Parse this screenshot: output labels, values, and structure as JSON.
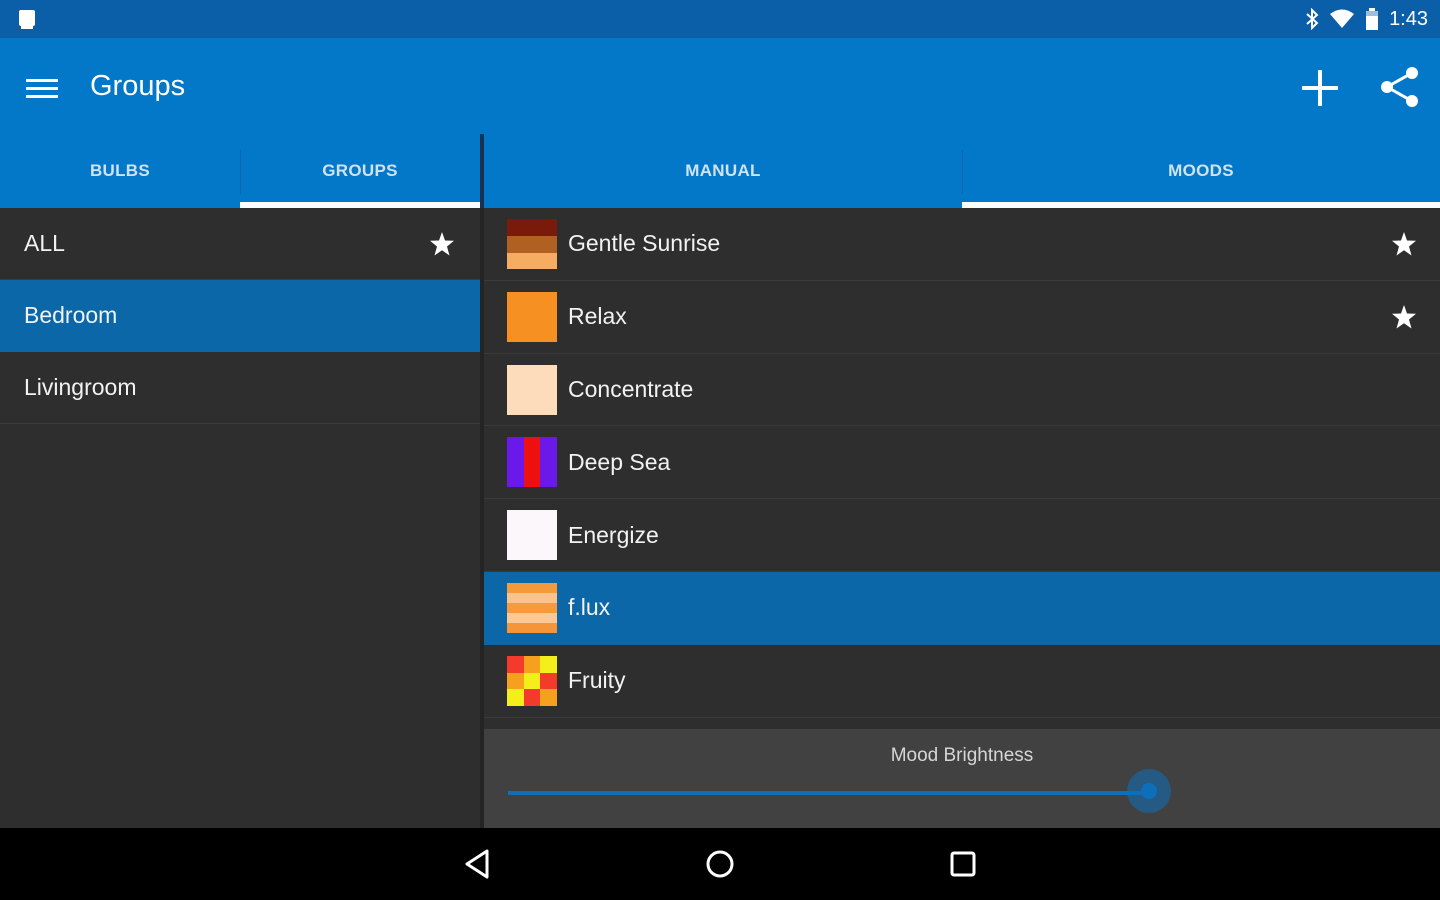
{
  "status_bar": {
    "time": "1:43",
    "icons": [
      "notification-icon",
      "bluetooth-icon",
      "wifi-icon",
      "battery-icon"
    ]
  },
  "app_bar": {
    "title": "Groups",
    "actions": [
      "add-icon",
      "share-icon"
    ]
  },
  "left_tabs": [
    {
      "label": "BULBS",
      "active": false
    },
    {
      "label": "GROUPS",
      "active": true
    }
  ],
  "right_tabs": [
    {
      "label": "MANUAL",
      "active": false
    },
    {
      "label": "MOODS",
      "active": true
    }
  ],
  "groups": [
    {
      "label": "ALL",
      "starred": true,
      "selected": false
    },
    {
      "label": "Bedroom",
      "starred": false,
      "selected": true
    },
    {
      "label": "Livingroom",
      "starred": false,
      "selected": false
    }
  ],
  "moods": [
    {
      "label": "Gentle Sunrise",
      "starred": true,
      "selected": false
    },
    {
      "label": "Relax",
      "starred": true,
      "selected": false
    },
    {
      "label": "Concentrate",
      "starred": false,
      "selected": false
    },
    {
      "label": "Deep Sea",
      "starred": false,
      "selected": false
    },
    {
      "label": "Energize",
      "starred": false,
      "selected": false
    },
    {
      "label": "f.lux",
      "starred": false,
      "selected": true
    },
    {
      "label": "Fruity",
      "starred": false,
      "selected": false
    }
  ],
  "brightness": {
    "label": "Mood Brightness",
    "value_fraction": 0.7
  },
  "colors": {
    "status_bar": "#0b5ea8",
    "app_bar": "#0478c8",
    "selected_row": "#0b67a8",
    "background": "#2e2e2e",
    "slider": "#0d6fba"
  }
}
